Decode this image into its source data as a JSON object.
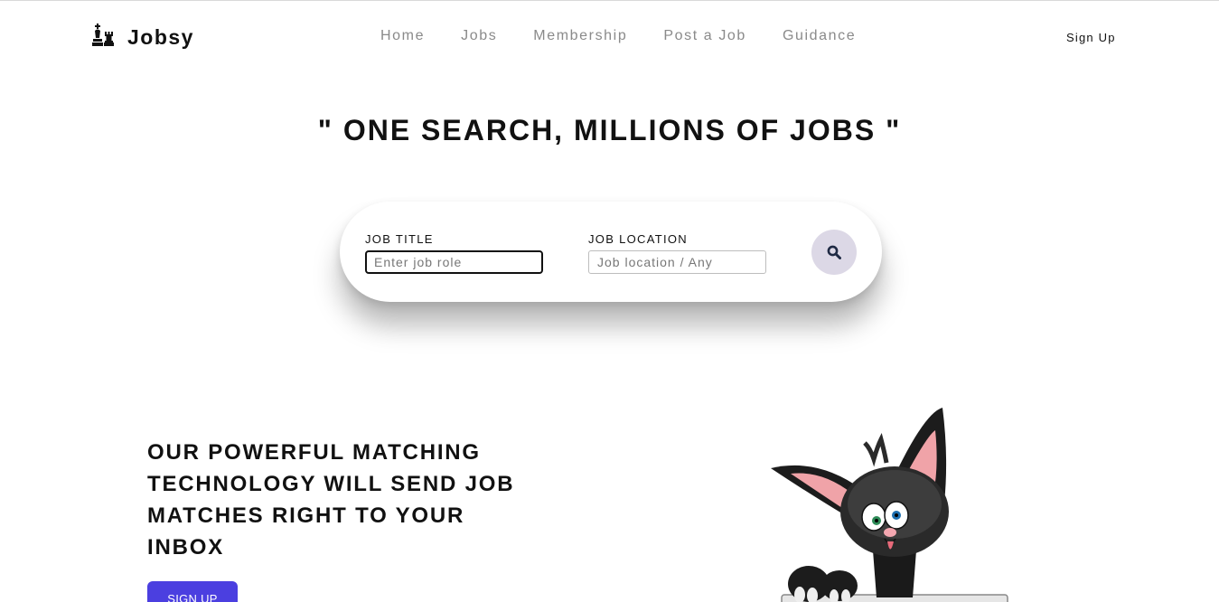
{
  "brand": {
    "name": "Jobsy",
    "logo_icon": "chess-pieces-icon"
  },
  "nav": {
    "items": [
      {
        "label": "Home"
      },
      {
        "label": "Jobs"
      },
      {
        "label": "Membership"
      },
      {
        "label": "Post a Job"
      },
      {
        "label": "Guidance"
      }
    ],
    "signup_label": "Sign Up"
  },
  "hero": {
    "title": "\" ONE SEARCH, MILLIONS OF JOBS \""
  },
  "search": {
    "job_title_label": "JOB TITLE",
    "job_title_placeholder": "Enter job role",
    "job_title_value": "",
    "job_location_label": "JOB LOCATION",
    "job_location_placeholder": "Job location / Any",
    "job_location_value": "",
    "button_icon": "search-icon"
  },
  "promo": {
    "text": "OUR POWERFUL MATCHING TECHNOLOGY WILL SEND JOB MATCHES RIGHT TO YOUR INBOX",
    "button_label": "SIGN UP",
    "image_icon": "cartoon-cat-mascot-icon"
  },
  "colors": {
    "accent": "#4b3fe0",
    "search_button": "#dcd8e6",
    "nav_text": "#8a8a8a"
  }
}
